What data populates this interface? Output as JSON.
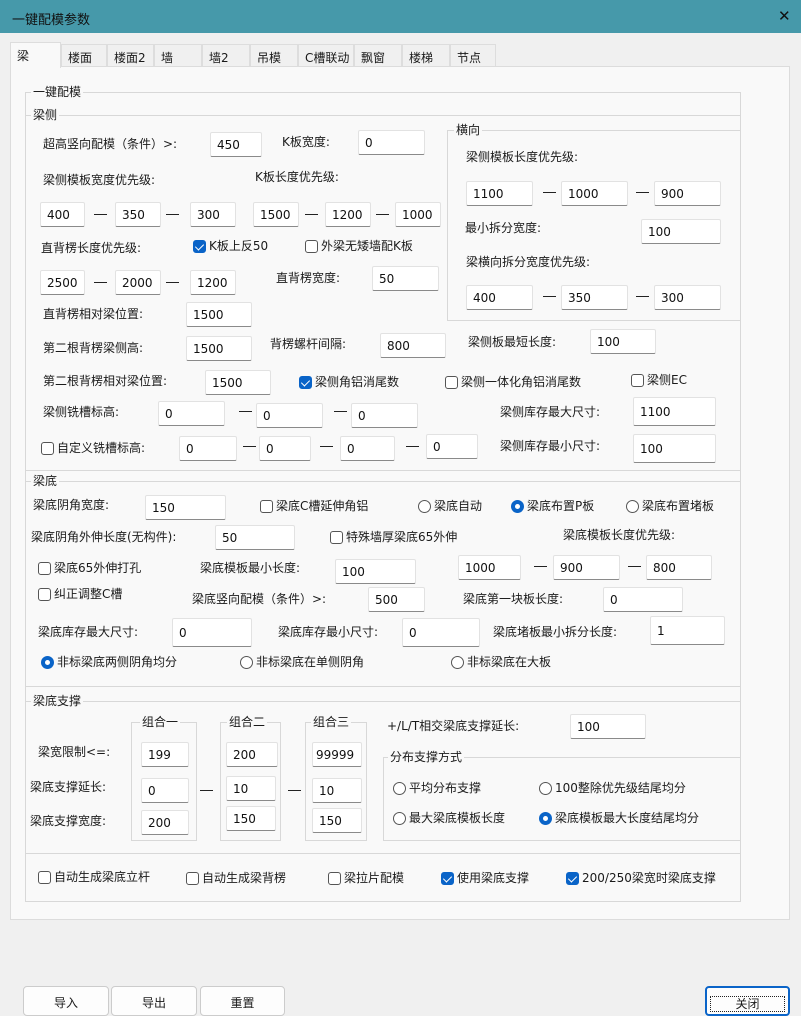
{
  "window": {
    "title": "一键配模参数",
    "close_icon": "✕"
  },
  "tabs": [
    "梁",
    "楼面",
    "楼面2",
    "墙",
    "墙2",
    "吊模",
    "C槽联动",
    "飘窗",
    "楼梯",
    "节点"
  ],
  "group_title": "一键配模",
  "beam_side": {
    "title": "梁侧",
    "over_height_label": "超高竖向配模（条件）>:",
    "over_height": "450",
    "k_width_label": "K板宽度:",
    "k_width": "0",
    "side_width_priority_label": "梁侧模板宽度优先级:",
    "side_width_priority": [
      "400",
      "350",
      "300"
    ],
    "k_length_priority_label": "K板长度优先级:",
    "k_length_priority": [
      "1500",
      "1200",
      "1000"
    ],
    "straight_len_priority_label": "直背楞长度优先级:",
    "straight_len_priority": [
      "2500",
      "2000",
      "1200"
    ],
    "k_up50_label": "K板上反50",
    "k_up50": true,
    "outer_beam_label": "外梁无矮墙配K板",
    "outer_beam": false,
    "straight_width_label": "直背楞宽度:",
    "straight_width": "50",
    "straight_pos_label": "直背楞相对梁位置:",
    "straight_pos": "1500",
    "second_height_label": "第二根背楞梁侧高:",
    "second_height": "1500",
    "bolt_spacing_label": "背楞螺杆间隔:",
    "bolt_spacing": "800",
    "min_len_label": "梁侧板最短长度:",
    "min_len": "100",
    "second_pos_label": "第二根背楞相对梁位置:",
    "second_pos": "1500",
    "corner_al_label": "梁侧角铝消尾数",
    "corner_al": true,
    "integrated_label": "梁侧一体化角铝消尾数",
    "integrated": false,
    "ec_label": "梁侧EC",
    "ec": false,
    "mill_label": "梁侧铣槽标高:",
    "mill": [
      "0",
      "0",
      "0"
    ],
    "stock_max_label": "梁侧库存最大尺寸:",
    "stock_max": "1100",
    "custom_mill_label": "自定义铣槽标高:",
    "custom_mill": false,
    "custom_mill_values": [
      "0",
      "0",
      "0",
      "0"
    ],
    "stock_min_label": "梁侧库存最小尺寸:",
    "stock_min": "100",
    "horizontal": {
      "title": "横向",
      "len_priority_label": "梁侧模板长度优先级:",
      "len_priority": [
        "1100",
        "1000",
        "900"
      ],
      "min_split_label": "最小拆分宽度:",
      "min_split": "100",
      "split_priority_label": "梁横向拆分宽度优先级:",
      "split_priority": [
        "400",
        "350",
        "300"
      ]
    }
  },
  "beam_bottom": {
    "title": "梁底",
    "corner_width_label": "梁底阴角宽度:",
    "corner_width": "150",
    "c_ext_label": "梁底C槽延伸角铝",
    "c_ext": false,
    "mode_options": [
      "梁底自动",
      "梁底布置P板",
      "梁底布置堵板"
    ],
    "mode_selected": "梁底布置P板",
    "corner_ext_label": "梁底阴角外伸长度(无构件):",
    "corner_ext": "50",
    "special_label": "特殊墙厚梁底65外伸",
    "special": false,
    "len_priority_label": "梁底模板长度优先级:",
    "len_priority": [
      "1000",
      "900",
      "800"
    ],
    "hole_label": "梁底65外伸打孔",
    "hole": false,
    "min_len_label": "梁底模板最小长度:",
    "min_len": "100",
    "fix_c_label": "纠正调整C槽",
    "fix_c": false,
    "vertical_label": "梁底竖向配模（条件）>:",
    "vertical": "500",
    "first_len_label": "梁底第一块板长度:",
    "first_len": "0",
    "stock_max_label": "梁底库存最大尺寸:",
    "stock_max": "0",
    "stock_min_label": "梁底库存最小尺寸:",
    "stock_min": "0",
    "plug_min_label": "梁底堵板最小拆分长度:",
    "plug_min": "1",
    "nonstd_options": [
      "非标梁底两侧阴角均分",
      "非标梁底在单侧阴角",
      "非标梁底在大板"
    ],
    "nonstd_selected": "非标梁底两侧阴角均分"
  },
  "support": {
    "title": "梁底支撑",
    "groups": [
      "组合一",
      "组合二",
      "组合三"
    ],
    "width_limit_label": "梁宽限制<=:",
    "width_limit": [
      "199",
      "200",
      "99999"
    ],
    "ext_label": "梁底支撑延长:",
    "ext": [
      "0",
      "10",
      "10"
    ],
    "width_label": "梁底支撑宽度:",
    "width": [
      "200",
      "150",
      "150"
    ],
    "cross_ext_label": "+/L/T相交梁底支撑延长:",
    "cross_ext": "100",
    "dist_title": "分布支撑方式",
    "dist_options": [
      "平均分布支撑",
      "100整除优先级结尾均分",
      "最大梁底模板长度",
      "梁底模板最大长度结尾均分"
    ],
    "dist_selected": "梁底模板最大长度结尾均分"
  },
  "options": [
    {
      "label": "自动生成梁底立杆",
      "checked": false
    },
    {
      "label": "自动生成梁背楞",
      "checked": false
    },
    {
      "label": "梁拉片配模",
      "checked": false
    },
    {
      "label": "使用梁底支撑",
      "checked": true
    },
    {
      "label": "200/250梁宽时梁底支撑",
      "checked": true
    }
  ],
  "buttons": {
    "import": "导入",
    "export": "导出",
    "reset": "重置",
    "close": "关闭"
  }
}
